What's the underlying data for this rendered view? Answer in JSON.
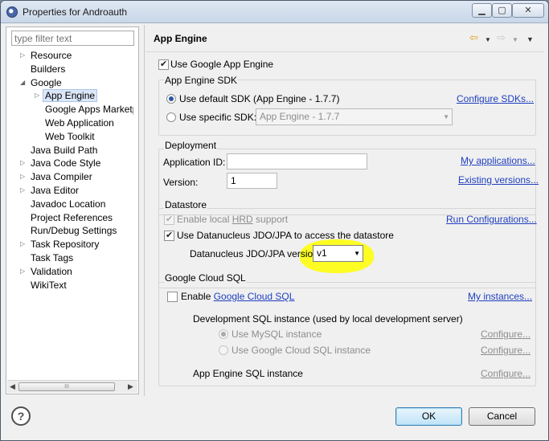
{
  "window": {
    "title": "Properties for Androauth",
    "controls": [
      "minimize",
      "maximize",
      "close"
    ]
  },
  "left_panel": {
    "filter_placeholder": "type filter text",
    "tree": [
      {
        "label": "Resource",
        "expander": "▷"
      },
      {
        "label": "Builders",
        "expander": ""
      },
      {
        "label": "Google",
        "expander": "◢"
      },
      {
        "label": "App Engine",
        "expander": "▷",
        "selected": true
      },
      {
        "label": "Google Apps Marketpla",
        "expander": ""
      },
      {
        "label": "Web Application",
        "expander": ""
      },
      {
        "label": "Web Toolkit",
        "expander": ""
      },
      {
        "label": "Java Build Path",
        "expander": ""
      },
      {
        "label": "Java Code Style",
        "expander": "▷"
      },
      {
        "label": "Java Compiler",
        "expander": "▷"
      },
      {
        "label": "Java Editor",
        "expander": "▷"
      },
      {
        "label": "Javadoc Location",
        "expander": ""
      },
      {
        "label": "Project References",
        "expander": ""
      },
      {
        "label": "Run/Debug Settings",
        "expander": ""
      },
      {
        "label": "Task Repository",
        "expander": "▷"
      },
      {
        "label": "Task Tags",
        "expander": ""
      },
      {
        "label": "Validation",
        "expander": "▷"
      },
      {
        "label": "WikiText",
        "expander": ""
      }
    ],
    "scroll_thumb": "III"
  },
  "page": {
    "title": "App Engine",
    "use_gae_label": "Use Google App Engine",
    "use_gae_checked": true,
    "sdk": {
      "group_label": "App Engine SDK",
      "default_label": "Use default SDK (App Engine - 1.7.7)",
      "specific_label": "Use specific SDK:",
      "specific_value": "App Engine - 1.7.7",
      "configure_link": "Configure SDKs..."
    },
    "deployment": {
      "group_label": "Deployment",
      "appid_label": "Application ID:",
      "appid_value": "",
      "version_label": "Version:",
      "version_value": "1",
      "my_apps_link": "My applications...",
      "existing_versions_link": "Existing versions..."
    },
    "datastore": {
      "group_label": "Datastore",
      "hrd_prefix": "Enable local ",
      "hrd_abbr": "HRD",
      "hrd_suffix": " support",
      "hrd_checked": true,
      "datanucleus_label": "Use Datanucleus JDO/JPA to access the datastore",
      "datanucleus_checked": true,
      "version_label": "Datanucleus JDO/JPA version:",
      "version_value": "v1",
      "run_config_link": "Run Configurations..."
    },
    "cloud_sql": {
      "group_label": "Google Cloud SQL",
      "enable_label": "Enable ",
      "enable_link": "Google Cloud SQL",
      "enable_checked": false,
      "my_instances_link": "My instances...",
      "dev_instance_label": "Development SQL instance (used by local development server)",
      "mysql_label": "Use MySQL instance",
      "cloudsql_label": "Use Google Cloud SQL instance",
      "configure_1": "Configure...",
      "configure_2": "Configure...",
      "gae_instance_label": "App Engine SQL instance",
      "configure_3": "Configure..."
    }
  },
  "footer": {
    "help": "?",
    "ok": "OK",
    "cancel": "Cancel"
  },
  "colors": {
    "link": "#1f3fbf",
    "highlight": "#ffff00",
    "selection": "#dbe7f8"
  },
  "icons": [
    "app-icon",
    "back-arrow-icon",
    "forward-arrow-icon",
    "view-menu-icon",
    "help-icon"
  ]
}
